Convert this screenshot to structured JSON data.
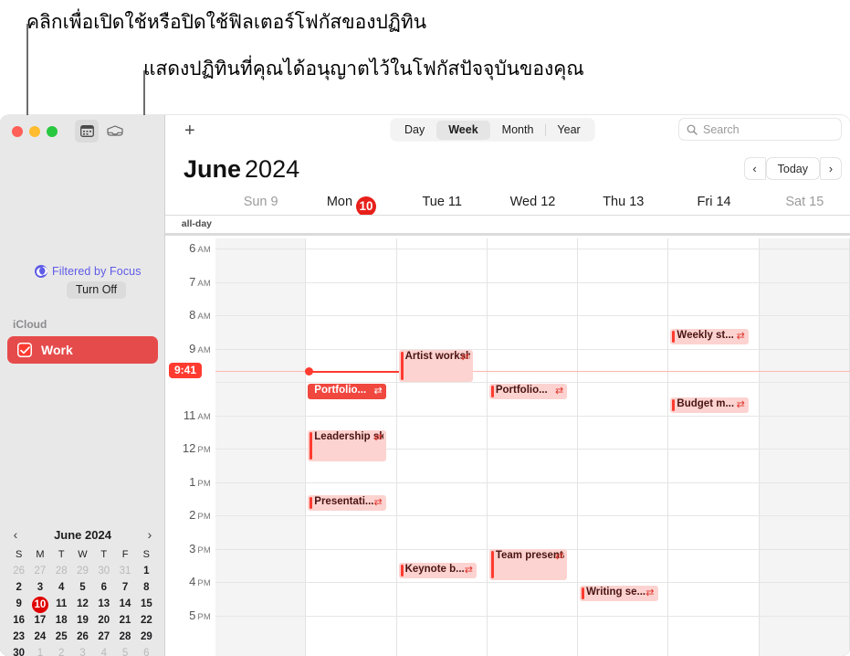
{
  "annotations": [
    {
      "text": "คลิกเพื่อเปิดใช้หรือปิดใช้ฟิลเตอร์โฟกัสของปฏิทิน"
    },
    {
      "text": "แสดงปฏิทินที่คุณได้อนุญาตไว้ในโฟกัสปัจจุบันของคุณ"
    }
  ],
  "sidebar": {
    "toolbar": {
      "calendar_view_icon": "calendar-icon",
      "inbox_icon": "inbox-icon"
    },
    "focus": {
      "icon": "moon-focus-icon",
      "label": "Filtered by Focus",
      "turn_off_label": "Turn Off",
      "accent": "#5e5ce6"
    },
    "account_label": "iCloud",
    "calendars": [
      {
        "name": "Work",
        "checked": true,
        "color": "#e64b4b"
      }
    ],
    "mini_calendar": {
      "title": "June 2024",
      "prev_icon": "chevron-left-icon",
      "next_icon": "chevron-right-icon",
      "dow": [
        "S",
        "M",
        "T",
        "W",
        "T",
        "F",
        "S"
      ],
      "today": 10,
      "weeks": [
        [
          {
            "d": 26,
            "m": true
          },
          {
            "d": 27,
            "m": true
          },
          {
            "d": 28,
            "m": true
          },
          {
            "d": 29,
            "m": true
          },
          {
            "d": 30,
            "m": true
          },
          {
            "d": 31,
            "m": true
          },
          {
            "d": 1,
            "m": false
          }
        ],
        [
          {
            "d": 2,
            "m": false
          },
          {
            "d": 3,
            "m": false
          },
          {
            "d": 4,
            "m": false
          },
          {
            "d": 5,
            "m": false
          },
          {
            "d": 6,
            "m": false
          },
          {
            "d": 7,
            "m": false
          },
          {
            "d": 8,
            "m": false
          }
        ],
        [
          {
            "d": 9,
            "m": false
          },
          {
            "d": 10,
            "m": false,
            "today": true
          },
          {
            "d": 11,
            "m": false
          },
          {
            "d": 12,
            "m": false
          },
          {
            "d": 13,
            "m": false
          },
          {
            "d": 14,
            "m": false
          },
          {
            "d": 15,
            "m": false
          }
        ],
        [
          {
            "d": 16,
            "m": false
          },
          {
            "d": 17,
            "m": false
          },
          {
            "d": 18,
            "m": false
          },
          {
            "d": 19,
            "m": false
          },
          {
            "d": 20,
            "m": false
          },
          {
            "d": 21,
            "m": false
          },
          {
            "d": 22,
            "m": false
          }
        ],
        [
          {
            "d": 23,
            "m": false
          },
          {
            "d": 24,
            "m": false
          },
          {
            "d": 25,
            "m": false
          },
          {
            "d": 26,
            "m": false
          },
          {
            "d": 27,
            "m": false
          },
          {
            "d": 28,
            "m": false
          },
          {
            "d": 29,
            "m": false
          }
        ],
        [
          {
            "d": 30,
            "m": false
          },
          {
            "d": 1,
            "m": true
          },
          {
            "d": 2,
            "m": true
          },
          {
            "d": 3,
            "m": true
          },
          {
            "d": 4,
            "m": true
          },
          {
            "d": 5,
            "m": true
          },
          {
            "d": 6,
            "m": true
          }
        ]
      ]
    }
  },
  "main": {
    "add_label": "+",
    "view_tabs": [
      {
        "label": "Day",
        "active": false
      },
      {
        "label": "Week",
        "active": true
      },
      {
        "label": "Month",
        "active": false
      },
      {
        "label": "Year",
        "active": false
      }
    ],
    "search": {
      "placeholder": "Search",
      "icon": "search-icon"
    },
    "title_month": "June",
    "title_year": "2024",
    "nav": {
      "prev": "‹",
      "today_label": "Today",
      "next": "›"
    },
    "all_day_label": "all-day",
    "days": [
      {
        "label": "Sun 9",
        "weekend": true
      },
      {
        "label": "Mon",
        "badge": "10",
        "weekend": false
      },
      {
        "label": "Tue 11",
        "weekend": false
      },
      {
        "label": "Wed 12",
        "weekend": false
      },
      {
        "label": "Thu 13",
        "weekend": false
      },
      {
        "label": "Fri 14",
        "weekend": false
      },
      {
        "label": "Sat 15",
        "weekend": true
      }
    ],
    "hours": [
      {
        "h": "6",
        "p": "AM"
      },
      {
        "h": "7",
        "p": "AM"
      },
      {
        "h": "8",
        "p": "AM"
      },
      {
        "h": "9",
        "p": "AM"
      },
      {
        "h": "11",
        "p": "AM"
      },
      {
        "h": "12",
        "p": "PM"
      },
      {
        "h": "1",
        "p": "PM"
      },
      {
        "h": "2",
        "p": "PM"
      },
      {
        "h": "3",
        "p": "PM"
      },
      {
        "h": "4",
        "p": "PM"
      },
      {
        "h": "5",
        "p": "PM"
      }
    ],
    "current_time": "9:41",
    "events": [
      {
        "title": "Artist workshop...",
        "day": 2,
        "repeat": true,
        "selected": false,
        "lines": 2
      },
      {
        "title": "Portfolio...",
        "day": 1,
        "repeat": true,
        "selected": true,
        "lines": 1
      },
      {
        "title": "Portfolio...",
        "day": 3,
        "repeat": true,
        "selected": false,
        "lines": 1
      },
      {
        "title": "Weekly st...",
        "day": 5,
        "repeat": true,
        "selected": false,
        "lines": 1
      },
      {
        "title": "Budget m...",
        "day": 5,
        "repeat": true,
        "selected": false,
        "lines": 1
      },
      {
        "title": "Leadership skills work...",
        "day": 1,
        "repeat": true,
        "selected": false,
        "lines": 2
      },
      {
        "title": "Presentati...",
        "day": 1,
        "repeat": true,
        "selected": false,
        "lines": 1
      },
      {
        "title": "Keynote b...",
        "day": 2,
        "repeat": true,
        "selected": false,
        "lines": 1
      },
      {
        "title": "Team presentati...",
        "day": 3,
        "repeat": true,
        "selected": false,
        "lines": 2
      },
      {
        "title": "Writing se...",
        "day": 4,
        "repeat": true,
        "selected": false,
        "lines": 1
      }
    ]
  }
}
